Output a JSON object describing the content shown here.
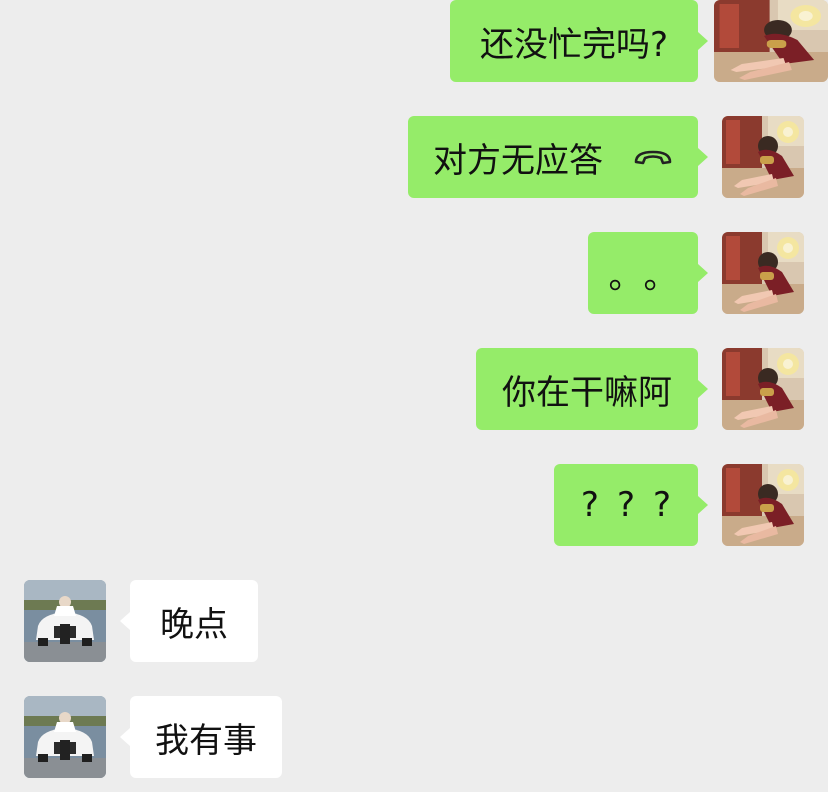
{
  "messages": [
    {
      "side": "sent",
      "text": "还没忙完吗?"
    },
    {
      "side": "sent",
      "text": "对方无应答",
      "icon": "hang-up-phone-icon"
    },
    {
      "side": "sent",
      "text": "。。"
    },
    {
      "side": "sent",
      "text": "你在干嘛阿"
    },
    {
      "side": "sent",
      "text": "???"
    },
    {
      "side": "received",
      "text": "晚点"
    },
    {
      "side": "received",
      "text": "我有事"
    }
  ],
  "colors": {
    "background": "#ededed",
    "sent_bubble": "#95ec69",
    "received_bubble": "#ffffff"
  },
  "avatars": {
    "self": "girl-sitting-on-floor-photo",
    "contact": "person-with-white-car-photo"
  }
}
